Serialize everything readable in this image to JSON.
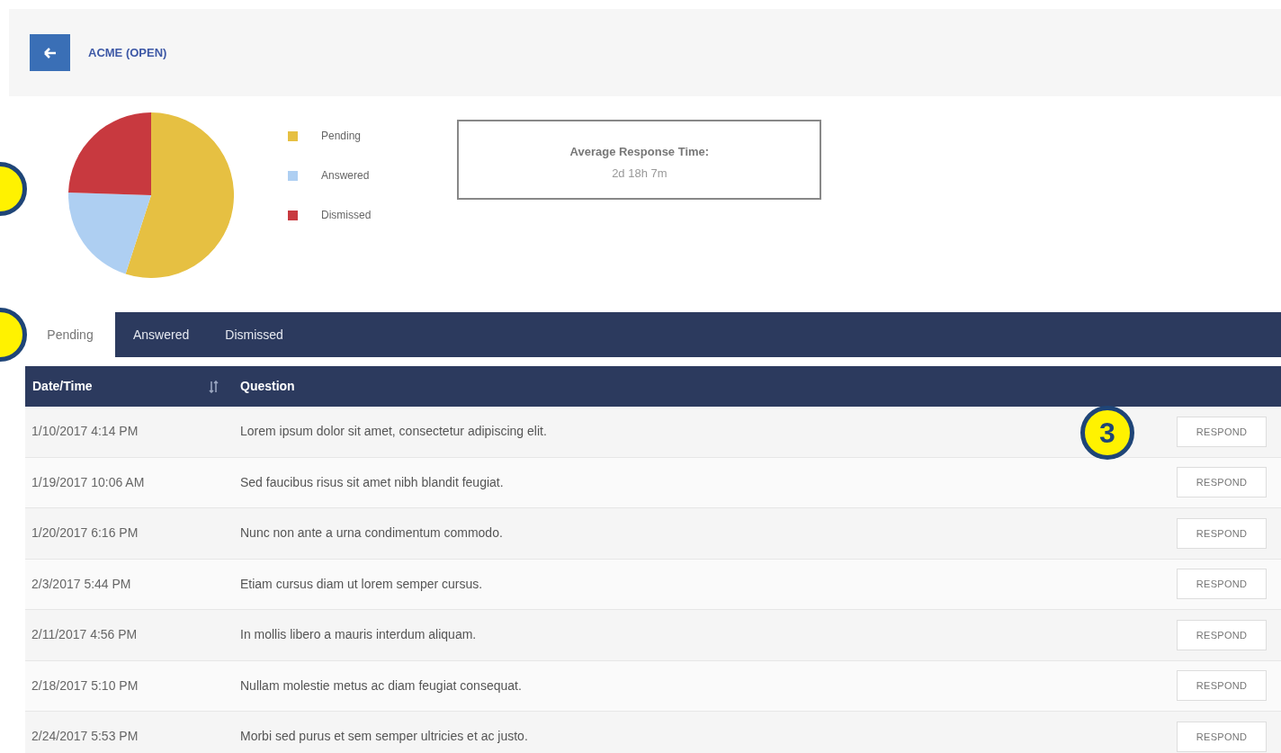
{
  "header": {
    "title": "ACME (OPEN)"
  },
  "legend": [
    {
      "label": "Pending",
      "color": "#e6c042"
    },
    {
      "label": "Answered",
      "color": "#aecff2"
    },
    {
      "label": "Dismissed",
      "color": "#c8393f"
    }
  ],
  "response_time": {
    "label": "Average Response Time:",
    "value": "2d 18h 7m"
  },
  "tabs": [
    {
      "label": "Pending",
      "selected": true
    },
    {
      "label": "Answered",
      "selected": false
    },
    {
      "label": "Dismissed",
      "selected": false
    }
  ],
  "table": {
    "columns": [
      "Date/Time",
      "Question"
    ],
    "rows": [
      {
        "date": "1/10/2017 4:14 PM",
        "question": "Lorem ipsum dolor sit amet, consectetur adipiscing elit.",
        "action": "RESPOND"
      },
      {
        "date": "1/19/2017 10:06 AM",
        "question": "Sed faucibus risus sit amet nibh blandit feugiat.",
        "action": "RESPOND"
      },
      {
        "date": "1/20/2017 6:16 PM",
        "question": "Nunc non ante a urna condimentum commodo.",
        "action": "RESPOND"
      },
      {
        "date": "2/3/2017 5:44 PM",
        "question": "Etiam cursus diam ut lorem semper cursus.",
        "action": "RESPOND"
      },
      {
        "date": "2/11/2017 4:56 PM",
        "question": "In mollis libero a mauris interdum aliquam.",
        "action": "RESPOND"
      },
      {
        "date": "2/18/2017 5:10 PM",
        "question": "Nullam molestie metus ac diam feugiat consequat.",
        "action": "RESPOND"
      },
      {
        "date": "2/24/2017 5:53 PM",
        "question": "Morbi sed purus et sem semper ultricies et ac justo.",
        "action": "RESPOND"
      }
    ]
  },
  "callouts": [
    {
      "kind": "chart"
    },
    {
      "kind": "tabs"
    },
    {
      "kind": "table",
      "label": "3"
    }
  ]
}
